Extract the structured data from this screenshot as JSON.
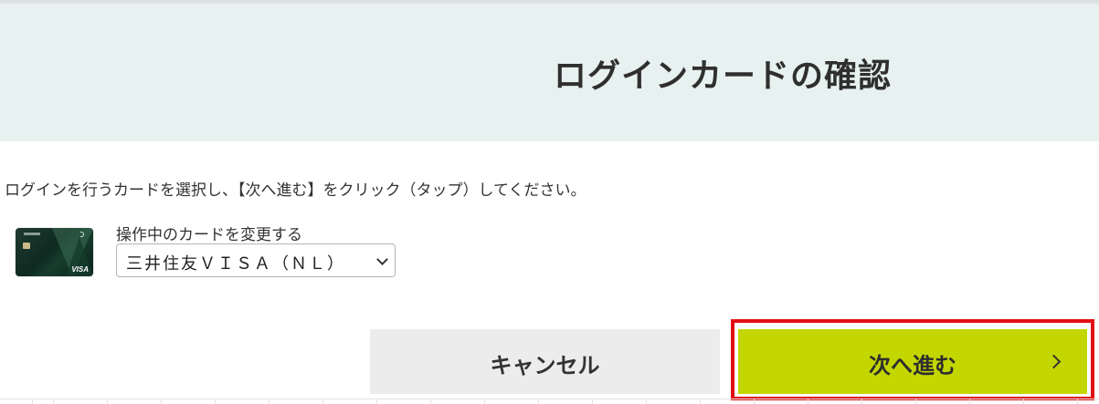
{
  "header": {
    "title": "ログインカードの確認",
    "background_color": "#e7f1f0"
  },
  "instruction": "ログインを行うカードを選択し、【次へ進む】をクリック（タップ）してください。",
  "card": {
    "image_icon": "credit-card-image",
    "brand_mark": "VISA"
  },
  "card_select": {
    "label": "操作中のカードを変更する",
    "selected_value": "三井住友ＶＩＳＡ（ＮＬ）"
  },
  "buttons": {
    "cancel_label": "キャンセル",
    "next_label": "次へ進む",
    "next_color": "#c4d600",
    "cancel_color": "#ececec"
  },
  "annotation": {
    "highlight_color": "#e10f13"
  }
}
